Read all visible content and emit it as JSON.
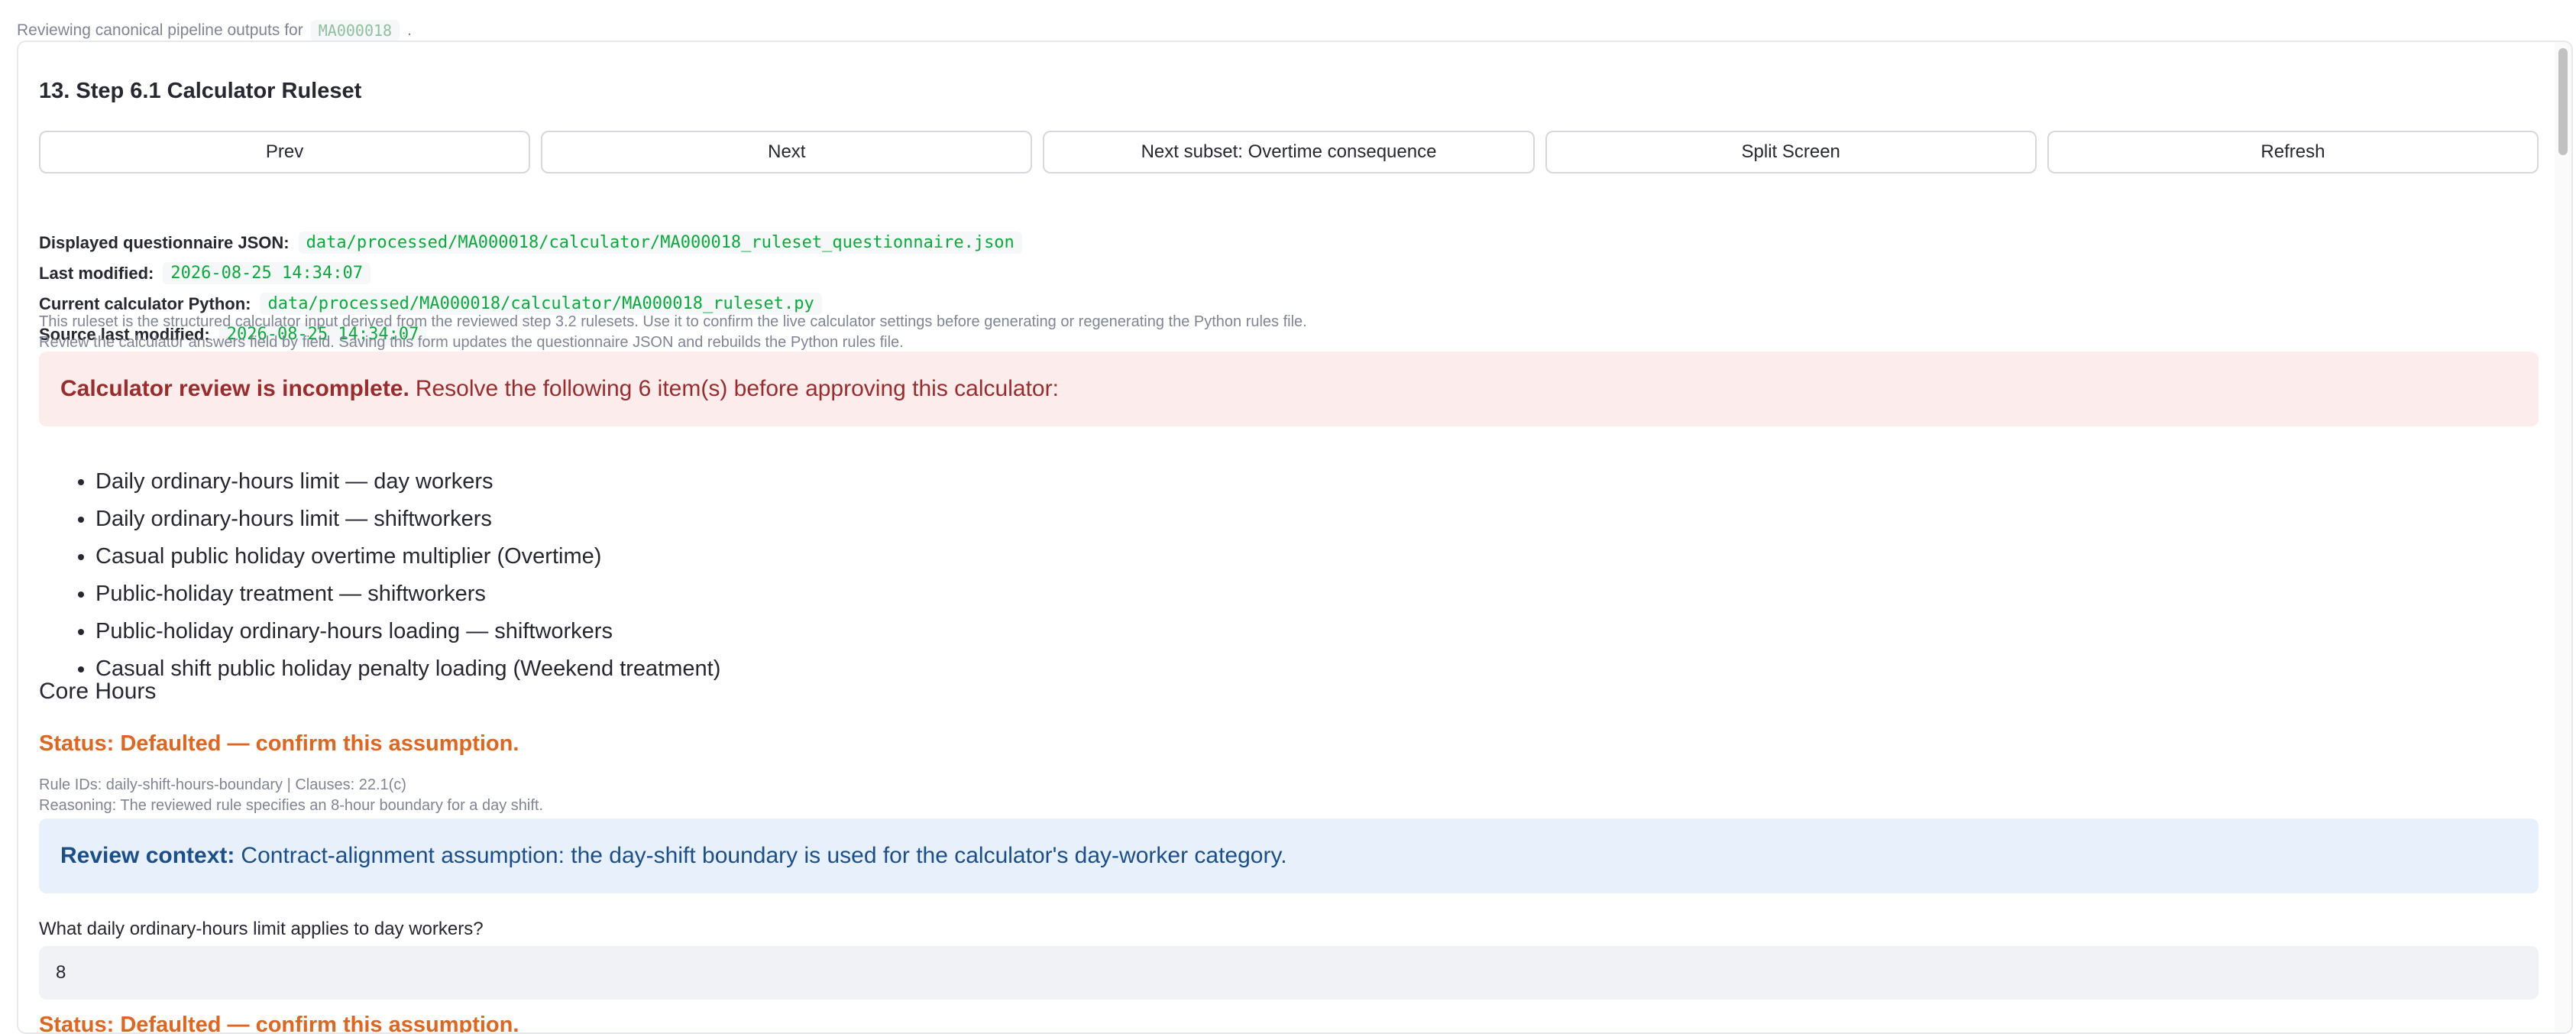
{
  "caption": {
    "text": "Reviewing canonical pipeline outputs for",
    "code": "MA000018",
    "suffix": "."
  },
  "section": {
    "title": "13. Step 6.1 Calculator Ruleset"
  },
  "buttons": {
    "prev": "Prev",
    "next": "Next",
    "next_subset": "Next subset: Overtime consequence",
    "split_screen": "Split Screen",
    "refresh": "Refresh"
  },
  "meta": {
    "displayed_json_label": "Displayed questionnaire JSON:",
    "displayed_json_path": "data/processed/MA000018/calculator/MA000018_ruleset_questionnaire.json",
    "last_modified_label": "Last modified:",
    "last_modified_value": "2026-08-25 14:34:07",
    "python_label": "Current calculator Python:",
    "python_path": "data/processed/MA000018/calculator/MA000018_ruleset.py",
    "source_modified_label": "Source last modified:",
    "source_modified_value": "2026-08-25 14:34:07"
  },
  "notes": {
    "line1": "This ruleset is the structured calculator input derived from the reviewed step 3.2 rulesets. Use it to confirm the live calculator settings before generating or regenerating the Python rules file.",
    "line2": "Review the calculator answers field by field. Saving this form updates the questionnaire JSON and rebuilds the Python rules file."
  },
  "error_alert": {
    "bold": "Calculator review is incomplete.",
    "text": "Resolve the following 6 item(s) before approving this calculator:"
  },
  "issues": [
    "Daily ordinary-hours limit — day workers",
    "Daily ordinary-hours limit — shiftworkers",
    "Casual public holiday overtime multiplier (Overtime)",
    "Public-holiday treatment — shiftworkers",
    "Public-holiday ordinary-hours loading — shiftworkers",
    "Casual shift public holiday penalty loading (Weekend treatment)"
  ],
  "core": {
    "title": "Core Hours",
    "status": "Status: Defaulted — confirm this assumption.",
    "rule_ids": "Rule IDs: daily-shift-hours-boundary | Clauses: 22.1(c)",
    "reasoning": "Reasoning: The reviewed rule specifies an 8-hour boundary for a day shift.",
    "info_bold": "Review context:",
    "info_text": "Contract-alignment assumption: the day-shift boundary is used for the calculator's day-worker category.",
    "question": "What daily ordinary-hours limit applies to day workers?",
    "answer": "8",
    "status2": "Status: Defaulted — confirm this assumption."
  },
  "colors": {
    "accent_code": "#09ab3b",
    "error_bg": "#fdecec",
    "error_text": "#9b2c2c",
    "info_bg": "#e8f0fb",
    "info_text": "#1a4f8b",
    "status_orange": "#e0651f"
  }
}
